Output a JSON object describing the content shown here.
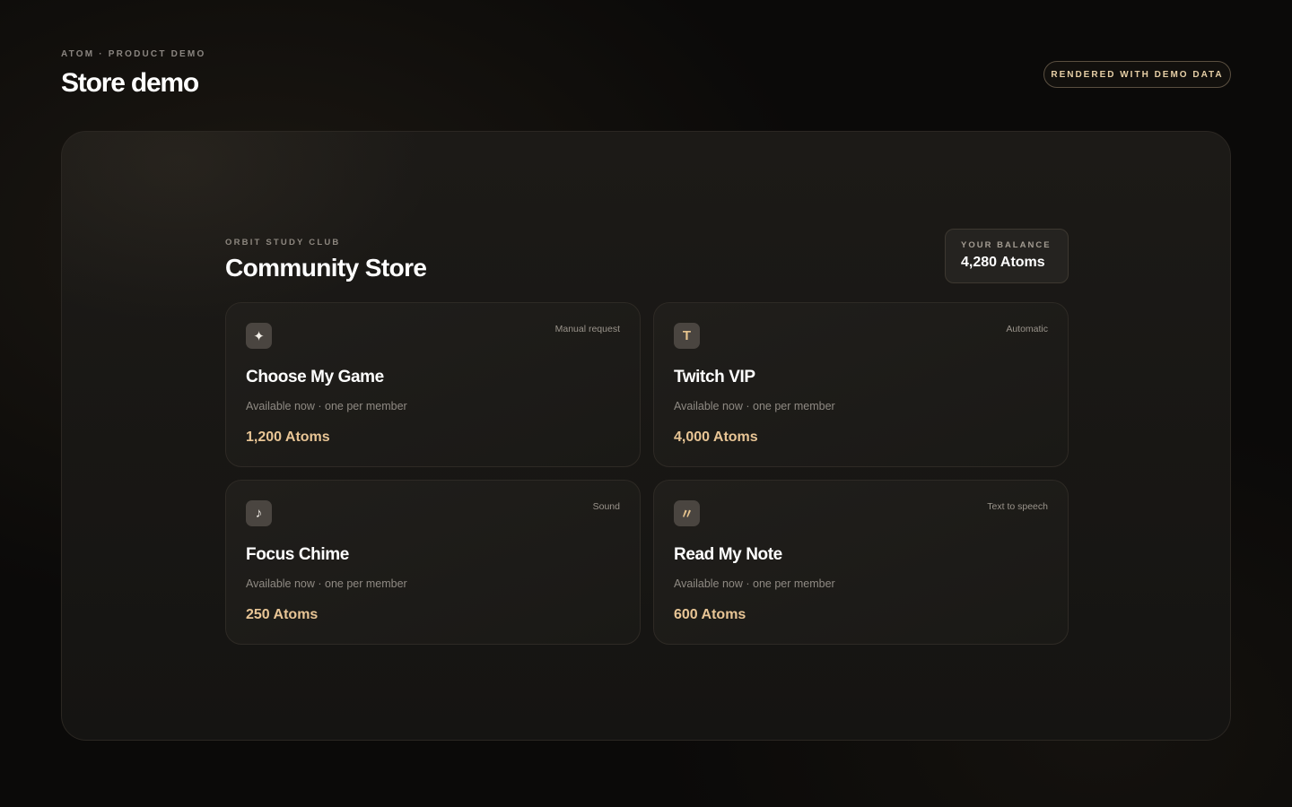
{
  "header": {
    "eyebrow": "ATOM · PRODUCT DEMO",
    "title": "Store demo",
    "badge": "RENDERED WITH DEMO DATA"
  },
  "store": {
    "eyebrow": "ORBIT STUDY CLUB",
    "title": "Community Store",
    "balance": {
      "label": "YOUR BALANCE",
      "value": "4,280 Atoms"
    },
    "items": [
      {
        "icon": "sparkle-icon",
        "glyph": "✦",
        "type": "Manual request",
        "title": "Choose My Game",
        "subtitle": "Available now · one per member",
        "price": "1,200 Atoms"
      },
      {
        "icon": "twitch-letter-icon",
        "glyph": "T",
        "type": "Automatic",
        "title": "Twitch VIP",
        "subtitle": "Available now · one per member",
        "price": "4,000 Atoms"
      },
      {
        "icon": "music-note-icon",
        "glyph": "♪",
        "type": "Sound",
        "title": "Focus Chime",
        "subtitle": "Available now · one per member",
        "price": "250 Atoms"
      },
      {
        "icon": "quote-icon",
        "glyph": "〃",
        "type": "Text to speech",
        "title": "Read My Note",
        "subtitle": "Available now · one per member",
        "price": "600 Atoms"
      }
    ]
  },
  "colors": {
    "accent": "#e8c595",
    "background": "#0b0a09",
    "card": "#1e1c19"
  }
}
